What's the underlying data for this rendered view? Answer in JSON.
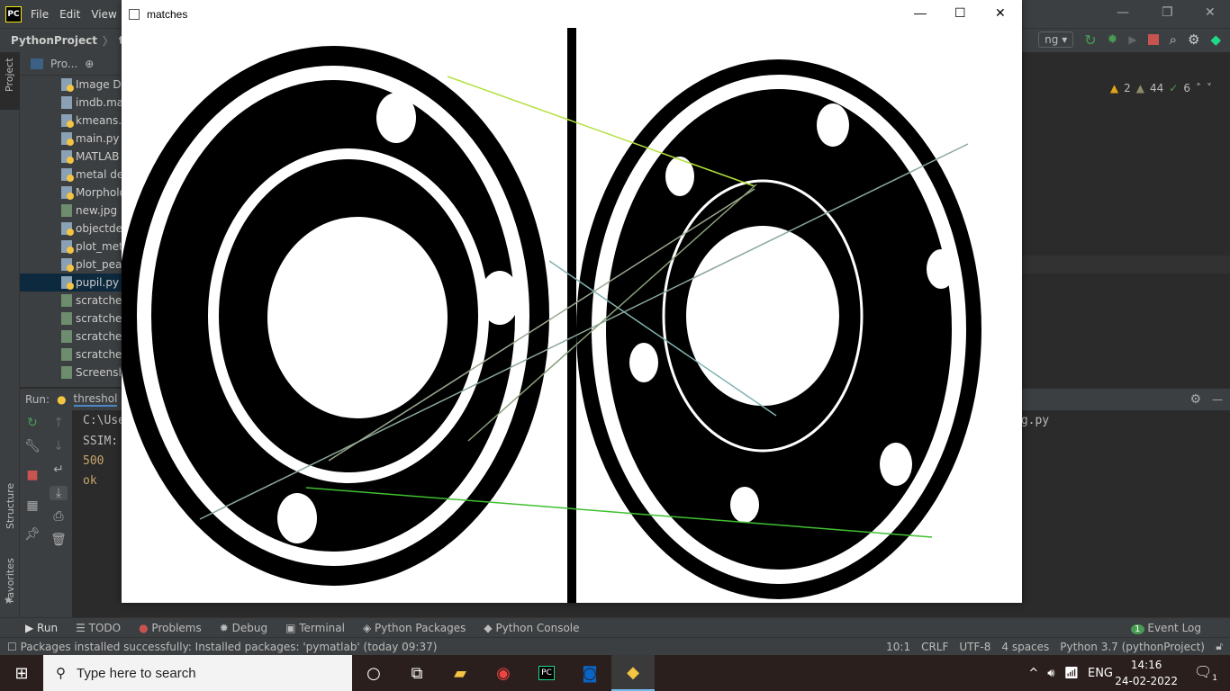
{
  "menubar": {
    "logo": "PC",
    "items": [
      "File",
      "Edit",
      "View"
    ]
  },
  "navbar": {
    "project": "PythonProject",
    "file": "th"
  },
  "toolbar": {
    "config": "ng"
  },
  "inspections": {
    "warnings": "2",
    "weak_warnings": "44",
    "typos": "6"
  },
  "project_panel": {
    "title": "Pro...",
    "tab": "Project",
    "files": [
      {
        "name": "Image Dif",
        "type": "py"
      },
      {
        "name": "imdb.mat",
        "type": "unknown"
      },
      {
        "name": "kmeans.py",
        "type": "py"
      },
      {
        "name": "main.py",
        "type": "py"
      },
      {
        "name": "MATLAB c",
        "type": "py"
      },
      {
        "name": "metal def",
        "type": "py"
      },
      {
        "name": "Morpholo",
        "type": "py"
      },
      {
        "name": "new.jpg",
        "type": "img"
      },
      {
        "name": "objectdet",
        "type": "py"
      },
      {
        "name": "plot_metr",
        "type": "py"
      },
      {
        "name": "plot_peak",
        "type": "py"
      },
      {
        "name": "pupil.py",
        "type": "py",
        "selected": true
      },
      {
        "name": "scratches_",
        "type": "img"
      },
      {
        "name": "scratches_",
        "type": "img"
      },
      {
        "name": "scratches_",
        "type": "img"
      },
      {
        "name": "scratches_",
        "type": "img"
      },
      {
        "name": "Screensho",
        "type": "img"
      }
    ]
  },
  "run": {
    "label": "Run:",
    "tab": "threshol",
    "console": [
      "C:\\Use",
      "SSIM:",
      "500",
      "ok"
    ],
    "console_tail": "ng.py"
  },
  "side_tabs": {
    "structure": "Structure",
    "favorites": "Favorites"
  },
  "bottom_tabs": [
    "Run",
    "TODO",
    "Problems",
    "Debug",
    "Terminal",
    "Python Packages",
    "Python Console"
  ],
  "event_log": {
    "count": "1",
    "label": "Event Log"
  },
  "status": {
    "message": "Packages installed successfully: Installed packages: 'pymatlab' (today 09:37)",
    "position": "10:1",
    "line_sep": "CRLF",
    "encoding": "UTF-8",
    "indent": "4 spaces",
    "interpreter": "Python 3.7 (pythonProject)"
  },
  "matches_window": {
    "title": "matches"
  },
  "taskbar": {
    "search_placeholder": "Type here to search",
    "language": "ENG",
    "time": "14:16",
    "date": "24-02-2022",
    "notifications": "1"
  }
}
